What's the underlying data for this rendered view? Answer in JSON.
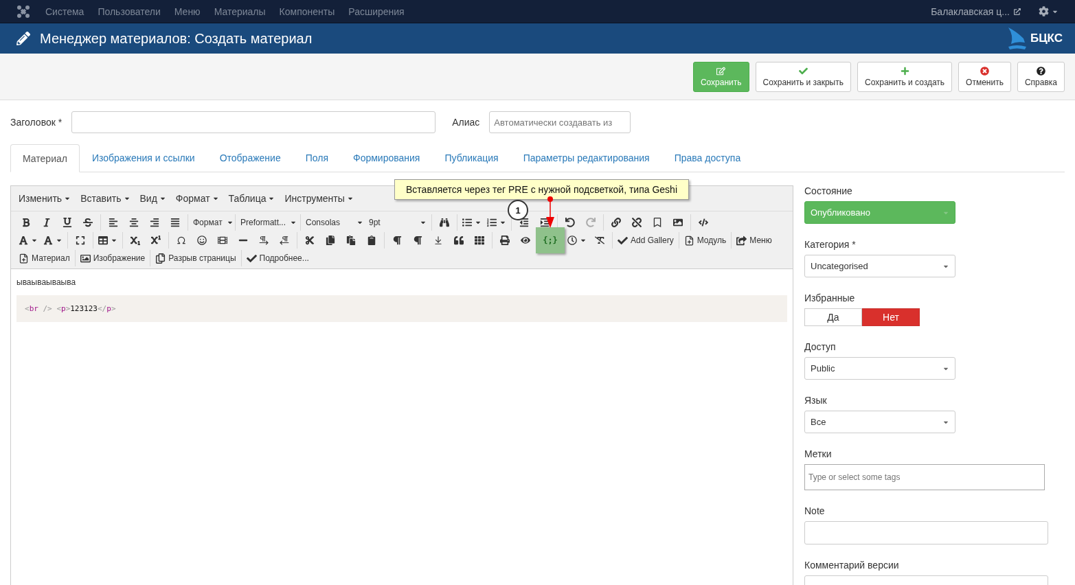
{
  "top_nav": {
    "menu": [
      {
        "label": "Система"
      },
      {
        "label": "Пользователи"
      },
      {
        "label": "Меню"
      },
      {
        "label": "Материалы"
      },
      {
        "label": "Компоненты"
      },
      {
        "label": "Расширения"
      }
    ],
    "site_link": "Балаклавская ц..."
  },
  "header": {
    "title": "Менеджер материалов: Создать материал",
    "logo_text": "БЦКС"
  },
  "actions": [
    {
      "label": "Сохранить",
      "kind": "primary"
    },
    {
      "label": "Сохранить и закрыть",
      "kind": "default"
    },
    {
      "label": "Сохранить и создать",
      "kind": "default"
    },
    {
      "label": "Отменить",
      "kind": "default"
    },
    {
      "label": "Справка",
      "kind": "default"
    }
  ],
  "fields": {
    "title_label": "Заголовок *",
    "alias_label": "Алиас",
    "alias_placeholder": "Автоматически создавать из"
  },
  "tabs": [
    {
      "label": "Материал",
      "selected": true
    },
    {
      "label": "Изображения и ссылки",
      "selected": false
    },
    {
      "label": "Отображение",
      "selected": false
    },
    {
      "label": "Поля",
      "selected": false
    },
    {
      "label": "Формирования",
      "selected": false
    },
    {
      "label": "Публикация",
      "selected": false
    },
    {
      "label": "Параметры редактирования",
      "selected": false
    },
    {
      "label": "Права доступа",
      "selected": false
    }
  ],
  "editor": {
    "menubar": [
      {
        "label": "Изменить"
      },
      {
        "label": "Вставить"
      },
      {
        "label": "Вид"
      },
      {
        "label": "Формат"
      },
      {
        "label": "Таблица"
      },
      {
        "label": "Инструменты"
      }
    ],
    "toolbar": [
      [
        [
          {
            "kind": "icon"
          },
          {
            "kind": "icon"
          },
          {
            "kind": "icon"
          },
          {
            "kind": "icon"
          }
        ],
        [
          {
            "kind": "icon"
          },
          {
            "kind": "icon"
          },
          {
            "kind": "icon"
          },
          {
            "kind": "icon"
          }
        ],
        [
          {
            "kind": "dropdown",
            "label": "Формат"
          }
        ],
        [
          {
            "kind": "dropdown",
            "label": "Preformatt..."
          }
        ],
        [
          {
            "kind": "dropdown",
            "label": "Consolas"
          },
          {
            "kind": "dropdown",
            "label": "9pt"
          }
        ],
        [
          {
            "kind": "icon"
          }
        ],
        [
          {
            "kind": "split"
          },
          {
            "kind": "split"
          }
        ],
        [
          {
            "kind": "icon"
          },
          {
            "kind": "icon"
          }
        ],
        [
          {
            "kind": "icon",
            "disabled": false
          },
          {
            "kind": "icon",
            "disabled": true
          }
        ],
        [
          {
            "kind": "icon"
          },
          {
            "kind": "icon"
          },
          {
            "kind": "icon"
          },
          {
            "kind": "icon"
          }
        ],
        [
          {
            "kind": "icon"
          }
        ]
      ],
      [
        [
          {
            "kind": "split"
          },
          {
            "kind": "split"
          }
        ],
        [
          {
            "kind": "icon"
          }
        ],
        [
          {
            "kind": "split"
          }
        ],
        [
          {
            "kind": "icon"
          },
          {
            "kind": "icon"
          }
        ],
        [
          {
            "kind": "icon"
          },
          {
            "kind": "icon"
          },
          {
            "kind": "icon"
          },
          {
            "kind": "icon"
          },
          {
            "kind": "icon"
          },
          {
            "kind": "icon"
          }
        ],
        [
          {
            "kind": "icon"
          },
          {
            "kind": "icon"
          },
          {
            "kind": "icon"
          },
          {
            "kind": "icon"
          }
        ],
        [
          {
            "kind": "icon"
          },
          {
            "kind": "icon"
          },
          {
            "kind": "icon"
          },
          {
            "kind": "icon"
          },
          {
            "kind": "icon"
          }
        ],
        [
          {
            "kind": "icon"
          },
          {
            "kind": "icon"
          },
          {
            "kind": "code",
            "label": "{;}",
            "highlighted": true
          },
          {
            "kind": "split"
          },
          {
            "kind": "icon"
          }
        ],
        [
          {
            "kind": "button",
            "label": "Add Gallery"
          }
        ],
        [
          {
            "kind": "button",
            "label": "Модуль"
          }
        ],
        [
          {
            "kind": "button",
            "label": "Меню"
          }
        ]
      ],
      [
        [
          {
            "kind": "button",
            "label": "Материал"
          }
        ],
        [
          {
            "kind": "button",
            "label": "Изображение"
          }
        ],
        [
          {
            "kind": "button",
            "label": "Разрыв страницы"
          }
        ],
        [
          {
            "kind": "button",
            "label": "Подробнее..."
          }
        ]
      ]
    ],
    "annotation": {
      "text": "Вставляется через тег PRE с нужной подсветкой, типа Geshi",
      "marker": "1"
    },
    "paragraph": "ываываываыва",
    "code_tokens": [
      {
        "kind": "punct",
        "text": "<"
      },
      {
        "kind": "tag",
        "text": "br"
      },
      {
        "kind": "punct",
        "text": " /> "
      },
      {
        "kind": "punct",
        "text": "<"
      },
      {
        "kind": "tag",
        "text": "p"
      },
      {
        "kind": "punct",
        "text": ">"
      },
      {
        "kind": "plain",
        "text": "123123"
      },
      {
        "kind": "punct",
        "text": "</"
      },
      {
        "kind": "tag",
        "text": "p"
      },
      {
        "kind": "punct",
        "text": ">"
      }
    ]
  },
  "sidebar": [
    {
      "kind": "status_select",
      "label": "Состояние",
      "value": "Опубликовано"
    },
    {
      "kind": "select",
      "label": "Категория *",
      "value": "Uncategorised"
    },
    {
      "kind": "toggle",
      "label": "Избранные",
      "options": [
        {
          "label": "Да",
          "selected": false
        },
        {
          "label": "Нет",
          "selected": true
        }
      ]
    },
    {
      "kind": "select",
      "label": "Доступ",
      "value": "Public"
    },
    {
      "kind": "select",
      "label": "Язык",
      "value": "Все"
    },
    {
      "kind": "tags",
      "label": "Метки",
      "placeholder": "Type or select some tags"
    },
    {
      "kind": "text",
      "label": "Note"
    },
    {
      "kind": "text",
      "label": "Комментарий версии"
    }
  ]
}
